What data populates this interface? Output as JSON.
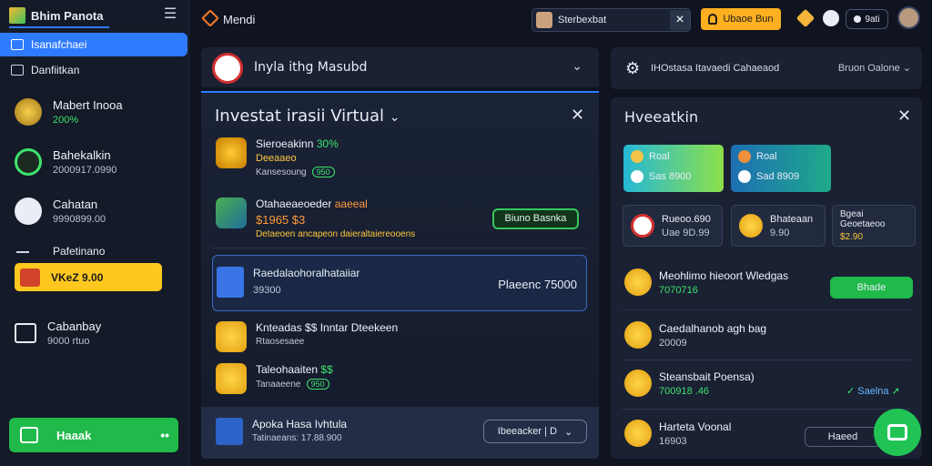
{
  "sidebar": {
    "brand": "Bhim Panota",
    "nav": [
      {
        "label": "Isanafchaei",
        "active": true
      },
      {
        "label": "Danfiitkan",
        "active": false
      }
    ],
    "rows": [
      {
        "title": "Mabert Inooa",
        "sub": "200%",
        "sub_green": true
      },
      {
        "title": "Bahekalkin",
        "sub": "2000917.0990",
        "sub_green": false
      },
      {
        "title": "Cahatan",
        "sub": "9990899.00",
        "sub_green": false
      },
      {
        "title": "Pafetinano",
        "sub": "",
        "sub_green": false
      }
    ],
    "highlight": "VKeZ 9.00",
    "extra": {
      "title": "Cabanbay",
      "sub": "9000 rtuo"
    },
    "cta": {
      "label": "Haaak",
      "dots": "••"
    }
  },
  "topbar": {
    "title": "Mendi",
    "search_value": "Sterbexbat",
    "cta": "Ubaoe Bun",
    "pill": "9ati"
  },
  "left_panel": {
    "header": "Inyla ithg Masubd",
    "title": "Investat irasii Virtual",
    "offers": [
      {
        "title": "Sieroeakinn",
        "title_g": "30%",
        "sub": "Deeaaeo",
        "meta": "Kansesoung",
        "badge": "950"
      },
      {
        "title": "Otahaeaeoeder",
        "title_g": "aaeeal",
        "sub": "$1965 $3",
        "meta": "Detaeoen ancapeon daieraltaiereooens"
      }
    ],
    "button": "Biuno Basnka",
    "selected": {
      "title": "Raedalaohoralhataiiar",
      "sub": "39300",
      "amount": "Plaeenc 75000"
    },
    "rows": [
      {
        "title": "Knteadas $$ Inntar Dteekeen",
        "meta": "Rtaosesaee"
      },
      {
        "title": "Taleohaaiten",
        "title_g": "$$",
        "meta": "Tanaaeene",
        "badge": "950"
      }
    ],
    "bottom": {
      "title": "Apoka Hasa Ivhtula",
      "meta": "Tatinaeans: 17.88.900",
      "btn": "Ibeeacker | D"
    }
  },
  "right_panel": {
    "header": {
      "title": "IHOstasa Itavaedi  Cahaeaod",
      "right": "Bruon Oalone"
    },
    "title": "Hveeatkin",
    "tiles": [
      {
        "l1": "Roal",
        "l2": "Sas 8900",
        "bg1": "#25b8d6",
        "bg2": "#8de04a"
      },
      {
        "l1": "Roal",
        "l2": "Sad 8909",
        "bg1": "#1d6fb3",
        "bg2": "#1faa8b"
      }
    ],
    "stats": [
      {
        "title": "Rueoo.690",
        "sub": "Uae 9D.99"
      },
      {
        "title": "Bhateaan",
        "sub": "9.90"
      },
      {
        "title": "Bgeai Geoetaeoo",
        "sub": "$2.90"
      }
    ],
    "rows": [
      {
        "title": "Meohlimo hieoort Wledgas",
        "sub": "7070716",
        "green": true
      },
      {
        "title": "Caedalhanob agh bag",
        "sub": "20009",
        "green": false
      },
      {
        "title": "Steansbait Poensa)",
        "sub": "700918 .46",
        "green": true
      },
      {
        "title": "Harteta Voonal",
        "sub": "16903",
        "green": false
      }
    ],
    "green_btn": "Bhade",
    "trend": "Saelna",
    "ghost_btn": "Haeed"
  }
}
